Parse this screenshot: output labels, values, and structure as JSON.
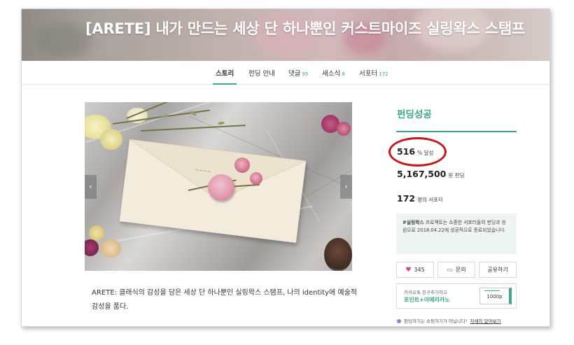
{
  "banner": {
    "title": "[ARETE] 내가 만드는 세상 단 하나뿐인 커스트마이즈 실링왁스 스탬프"
  },
  "tabs": [
    {
      "label": "스토리",
      "count": ""
    },
    {
      "label": "펀딩 안내",
      "count": ""
    },
    {
      "label": "댓글",
      "count": "95"
    },
    {
      "label": "새소식",
      "count": "8"
    },
    {
      "label": "서포터",
      "count": "172"
    }
  ],
  "gallery": {
    "prev_icon": "chevron-left-icon",
    "next_icon": "chevron-right-icon"
  },
  "description": "ARETE: 클래식의 감성을 담은 세상 단 하나뿐인 실링왁스 스탬프, 나의 identity에 예술적 감성을 품다.",
  "funding": {
    "status": "펀딩성공",
    "percent": "516",
    "percent_unit": "% 달성",
    "amount": "5,167,500",
    "amount_unit": "원 펀딩",
    "supporters": "172",
    "supporters_unit": "명의 서포터",
    "notice_tag": "#실링왁스",
    "notice_text": " 프로젝트는 소중한 서포터들의 펀딩과 응원으로 2018.04.22에 성공적으로 종료되었습니다."
  },
  "actions": {
    "like_count": "345",
    "inquiry_label": "문의",
    "share_label": "공유하기",
    "like_icon": "heart-icon",
    "inquiry_icon": "chat-icon"
  },
  "kakao": {
    "line1": "카카오톡 친구추가하고",
    "line2": "포인트+아메리카노",
    "coupon": "1000p"
  },
  "footnote": {
    "text": "펀딩하기는 쇼핑하기가 아닙니다!",
    "link": "자세히 알아보기"
  },
  "colors": {
    "accent": "#39a98b",
    "highlight_circle": "#c8161d",
    "notice_bg": "#eef5f3"
  }
}
